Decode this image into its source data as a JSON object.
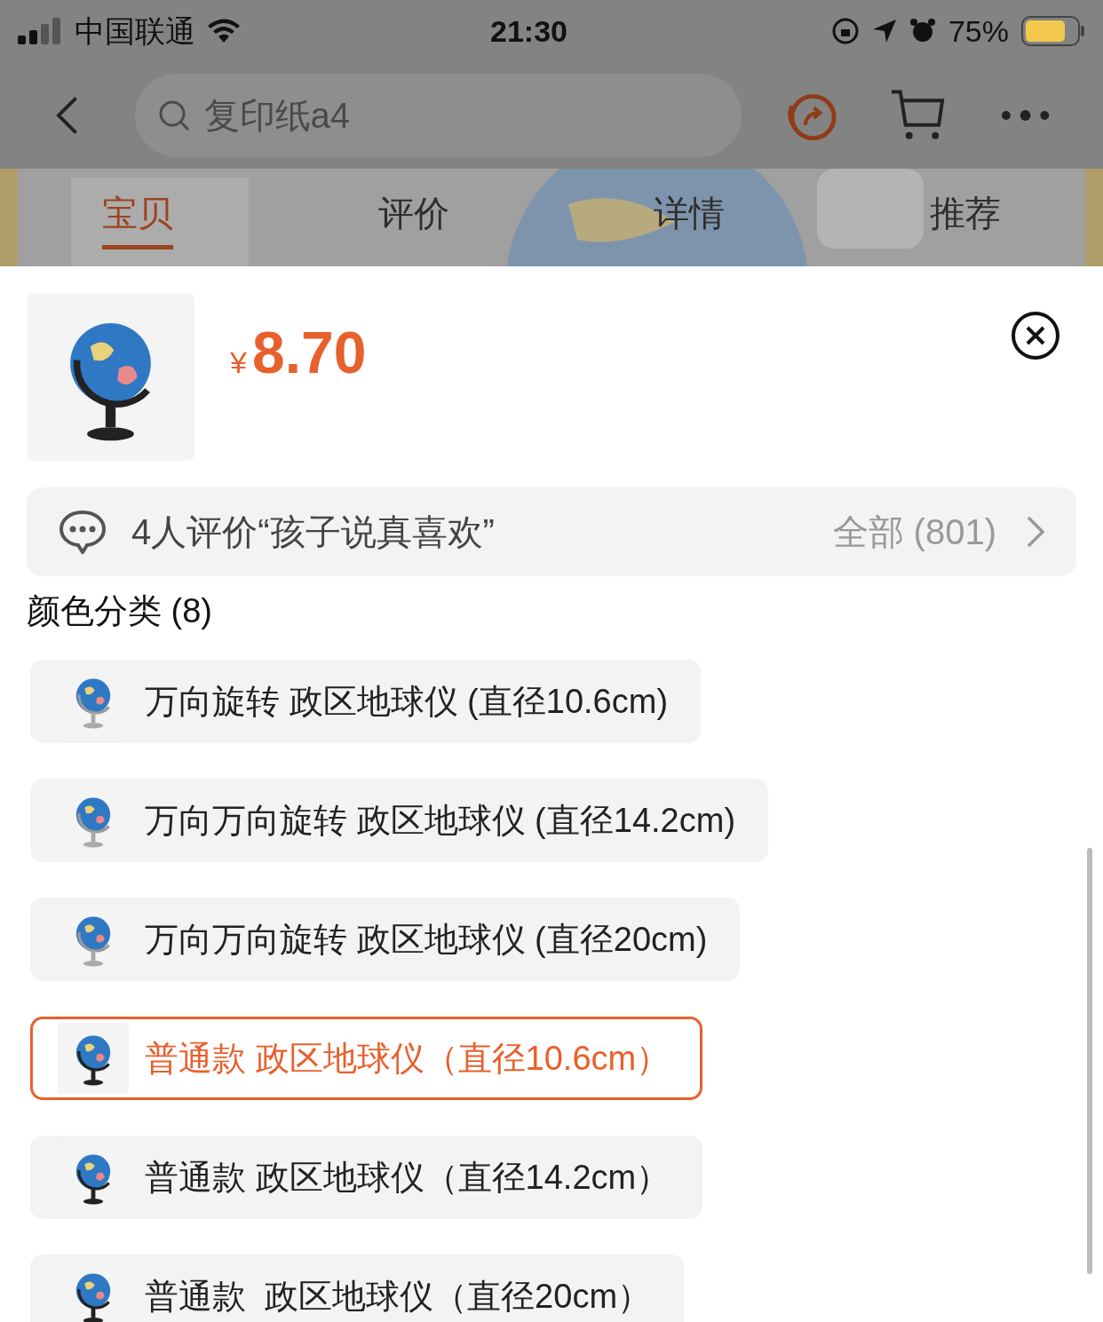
{
  "status_bar": {
    "carrier": "中国联通",
    "time": "21:30",
    "battery": "75%"
  },
  "nav": {
    "search_placeholder": "复印纸a4"
  },
  "tabs": [
    {
      "label": "宝贝",
      "selected": true
    },
    {
      "label": "评价",
      "selected": false
    },
    {
      "label": "详情",
      "selected": false
    },
    {
      "label": "推荐",
      "selected": false
    }
  ],
  "product": {
    "currency": "¥",
    "price": "8.70"
  },
  "review_bar": {
    "text": "4人评价“孩子说真喜欢”",
    "count": "全部 (801)"
  },
  "options_heading": "颜色分类 (8)",
  "options": [
    {
      "label": "万向旋转 政区地球仪 (直径10.6cm)",
      "selected": false
    },
    {
      "label": "万向万向旋转 政区地球仪 (直径14.2cm)",
      "selected": false
    },
    {
      "label": "万向万向旋转 政区地球仪 (直径20cm)",
      "selected": false
    },
    {
      "label": "普通款 政区地球仪（直径10.6cm）",
      "selected": true
    },
    {
      "label": "普通款 政区地球仪（直径14.2cm）",
      "selected": false
    },
    {
      "label": "普通款  政区地球仪（直径20cm）",
      "selected": false
    }
  ]
}
